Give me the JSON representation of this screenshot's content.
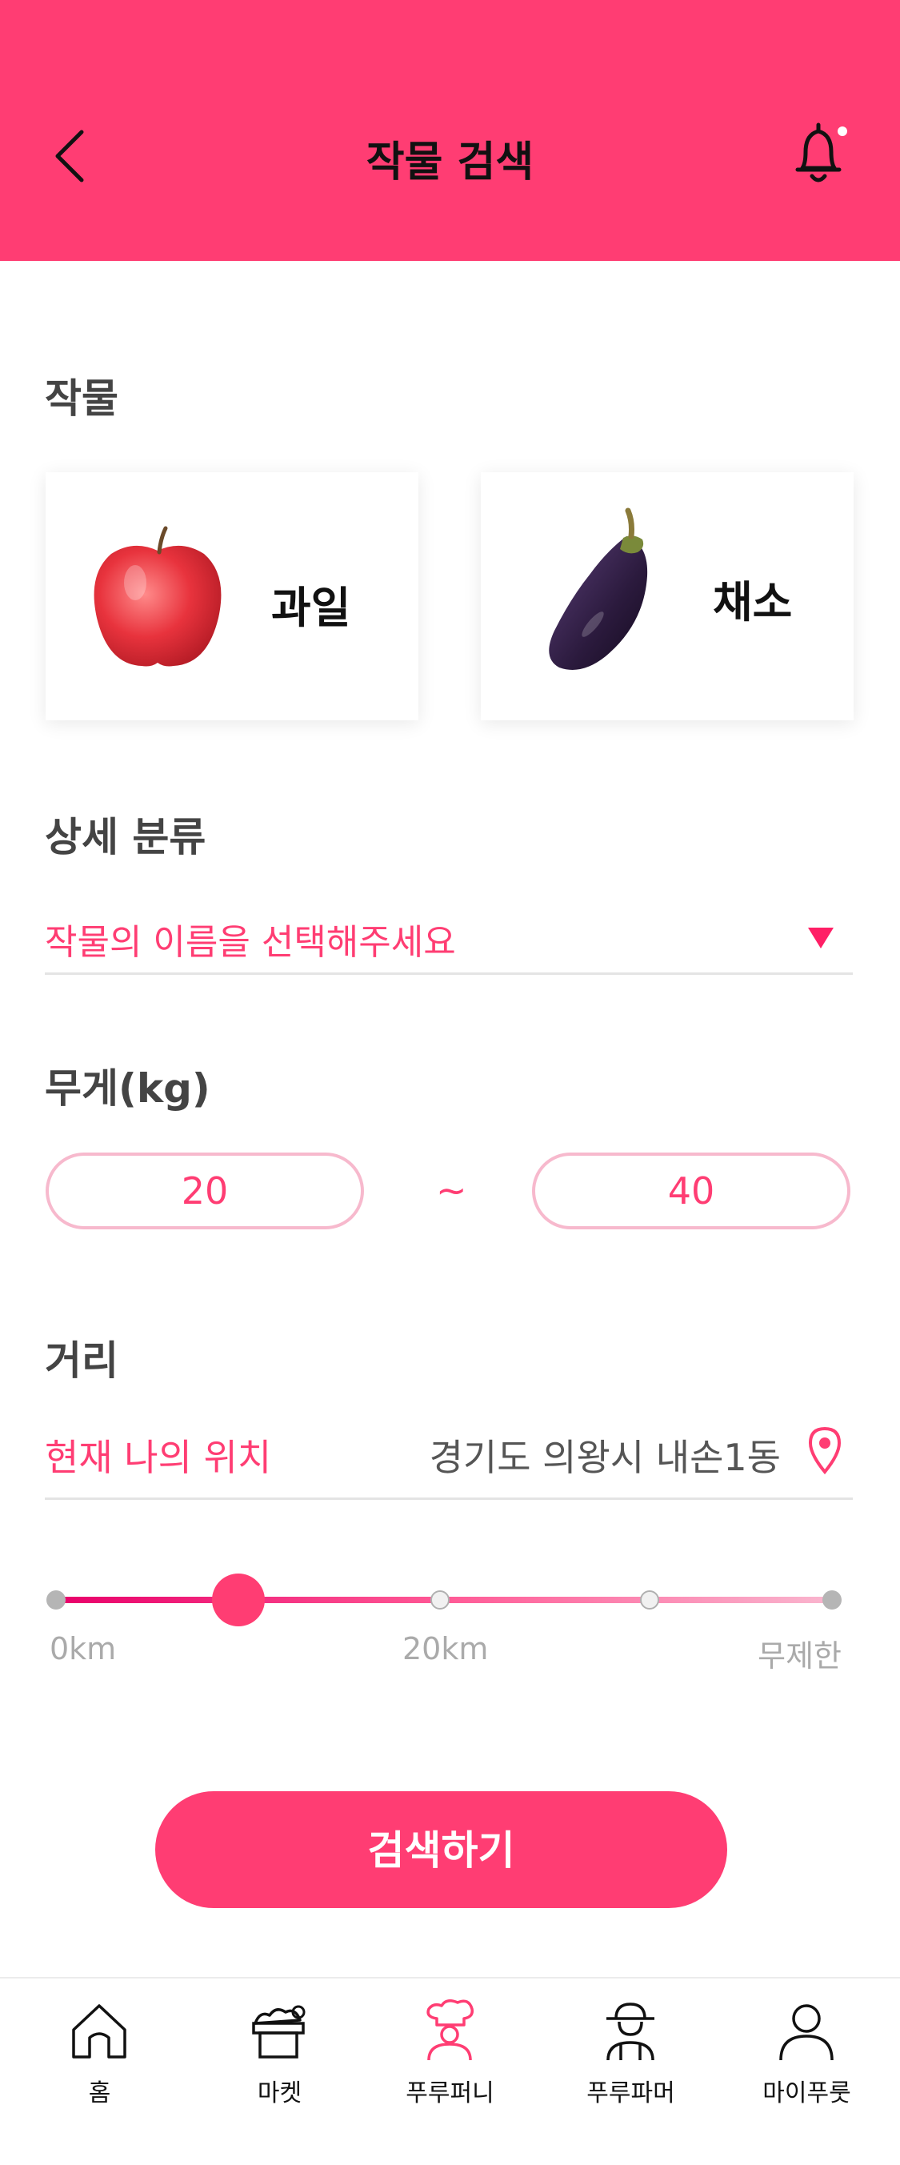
{
  "header": {
    "title": "작물 검색",
    "back_icon": "chevron-left-icon",
    "bell_icon": "bell-icon",
    "background": "#ff3d73"
  },
  "crops": {
    "label": "작물",
    "items": [
      {
        "label": "과일",
        "icon": "apple-image"
      },
      {
        "label": "채소",
        "icon": "eggplant-image"
      }
    ]
  },
  "detail": {
    "label": "상세 분류",
    "placeholder": "작물의 이름을 선택해주세요",
    "arrow_icon": "triangle-down-icon"
  },
  "weight": {
    "label": "무게(kg)",
    "min": "20",
    "separator": "~",
    "max": "40"
  },
  "distance": {
    "label": "거리",
    "location_label": "현재 나의 위치",
    "address": "경기도 의왕시 내손1동",
    "pin_icon": "location-pin-icon",
    "slider": {
      "ticks": [
        "0km",
        "20km",
        "무제한"
      ],
      "value_fraction": 0.23
    }
  },
  "search_button": "검색하기",
  "tabbar": {
    "items": [
      {
        "label": "홈",
        "icon": "home-icon",
        "active": false
      },
      {
        "label": "마켓",
        "icon": "market-basket-icon",
        "active": false
      },
      {
        "label": "푸루퍼니",
        "icon": "chef-icon",
        "active": true
      },
      {
        "label": "푸루파머",
        "icon": "farmer-icon",
        "active": false
      },
      {
        "label": "마이푸룻",
        "icon": "person-icon",
        "active": false
      }
    ]
  },
  "colors": {
    "accent": "#ff3d73",
    "accent_light": "#f7b9cd",
    "text_dark": "#444444"
  }
}
